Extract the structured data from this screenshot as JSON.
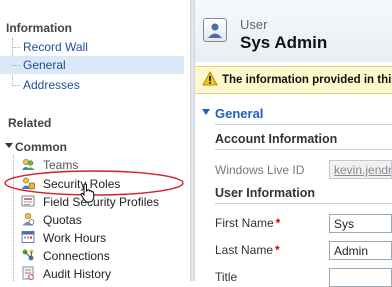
{
  "nav": {
    "information_title": "Information",
    "information_items": [
      "Record Wall",
      "General",
      "Addresses"
    ],
    "related_title": "Related",
    "common_title": "Common",
    "common_items": [
      "Teams",
      "Security Roles",
      "Field Security Profiles",
      "Quotas",
      "Work Hours",
      "Connections",
      "Audit History"
    ],
    "selected_item": "General"
  },
  "header": {
    "entity_type": "User",
    "record_name": "Sys Admin"
  },
  "notification": {
    "text": "The information provided in this"
  },
  "form": {
    "section_title": "General",
    "account_info_title": "Account Information",
    "windows_live_id_label": "Windows Live ID",
    "windows_live_id_value": "kevin.jendro",
    "user_info_title": "User Information",
    "first_name_label": "First Name",
    "first_name_value": "Sys",
    "last_name_label": "Last Name",
    "last_name_value": "Admin",
    "title_label": "Title",
    "title_value": "",
    "required_marker": "*"
  },
  "colors": {
    "link_blue": "#1f4e9c",
    "selection_bg": "#dbe8f7",
    "warning_bg": "#fff8cc",
    "highlight_ellipse": "#d0202a",
    "required": "#cc0000"
  }
}
